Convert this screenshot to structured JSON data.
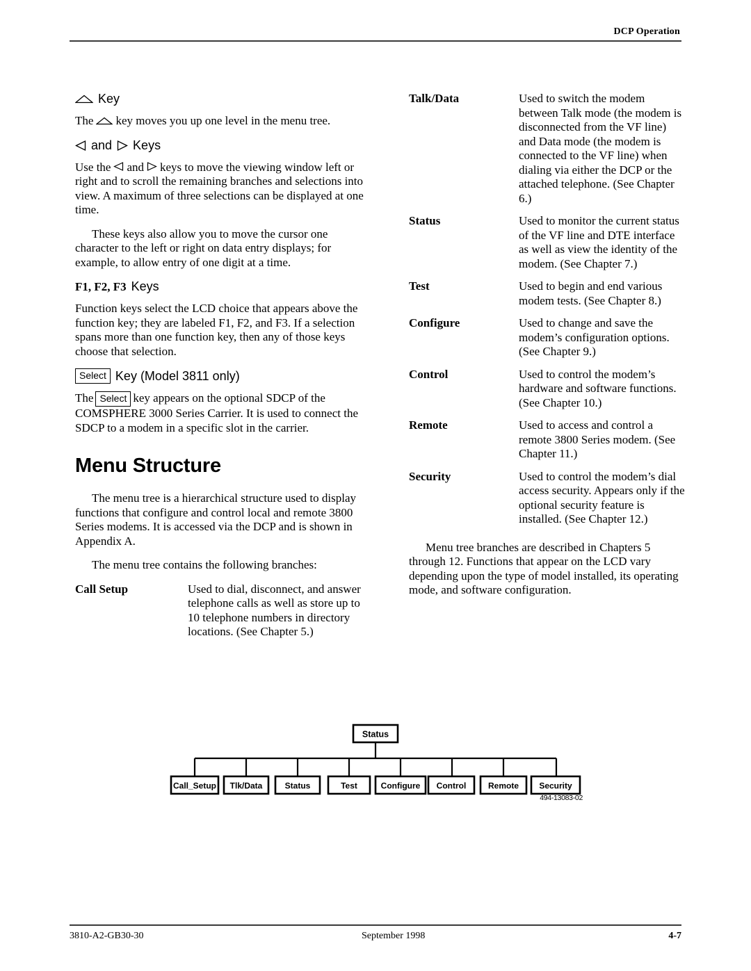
{
  "header": {
    "title": "DCP Operation"
  },
  "footer": {
    "doc_number": "3810-A2-GB30-30",
    "date": "September 1998",
    "page_number": "4-7"
  },
  "left_column": {
    "up_key_heading": {
      "glyph": "up-triangle-icon",
      "label": "Key"
    },
    "up_key_para_a": "The",
    "up_key_para_b": "key moves you up one level in the menu tree.",
    "lr_key_heading": {
      "left_glyph": "left-triangle-icon",
      "and": "and",
      "right_glyph": "right-triangle-icon",
      "label": "Keys"
    },
    "lr_key_para_a": "Use the",
    "lr_key_para_b": "and",
    "lr_key_para_c": "keys to move the viewing window left or right and to scroll the remaining branches and selections into view. A maximum of three selections can be displayed at one time.",
    "cursor_para": "These keys also allow you to move the cursor one character to the left or right on data entry displays; for example, to allow entry of one digit at a time.",
    "function_keys_heading": {
      "bold_part": "F1, F2, F3",
      "label": "Keys"
    },
    "function_keys_para": "Function keys select the LCD choice that appears above the function key; they are labeled F1, F2, and F3. If a selection spans more than one function key, then any of those keys choose that selection.",
    "select_key_heading": {
      "keybox": "Select",
      "label": "Key (Model 3811 only)"
    },
    "select_para_a": "The",
    "select_para_keybox": "Select",
    "select_para_b": "key appears on the optional SDCP of the COMSPHERE 3000 Series Carrier. It is used to connect the SDCP to a modem in a specific slot in the carrier.",
    "menu_structure_title": "Menu Structure",
    "menu_structure_para1": "The menu tree is a hierarchical structure used to display functions that configure and control local and remote 3800 Series modems. It is accessed via the DCP and is shown in Appendix A.",
    "menu_structure_para2": "The menu tree contains the following branches:",
    "branches": [
      {
        "term": "Call Setup",
        "description": "Used to dial, disconnect, and answer telephone calls as well as store up to 10 telephone numbers in directory locations. (See Chapter 5.)"
      }
    ]
  },
  "right_column": {
    "branches": [
      {
        "term": "Talk/Data",
        "description": "Used to switch the modem between Talk mode (the modem is disconnected from the VF line) and Data mode (the modem is connected to the VF line) when dialing via either the DCP or the attached telephone. (See Chapter 6.)"
      },
      {
        "term": "Status",
        "description": "Used to monitor the current status of the VF line and DTE interface as well as view the identity of the modem. (See Chapter 7.)"
      },
      {
        "term": "Test",
        "description": "Used to begin and end various modem tests. (See Chapter 8.)"
      },
      {
        "term": "Configure",
        "description": "Used to change and save the modem’s configuration options. (See Chapter 9.)"
      },
      {
        "term": "Control",
        "description": "Used to control the modem’s hardware and software functions. (See Chapter 10.)"
      },
      {
        "term": "Remote",
        "description": "Used to access and control a remote 3800 Series modem. (See Chapter 11.)"
      },
      {
        "term": "Security",
        "description": "Used to control the modem’s dial access security. Appears only if the optional security feature is installed. (See Chapter 12.)"
      }
    ],
    "closing_para": "Menu tree branches are described in Chapters 5 through 12. Functions that appear on the LCD vary depending upon the type of model installed, its operating mode, and software configuration."
  },
  "figure": {
    "root": "Status",
    "children": [
      "Call_Setup",
      "Tlk/Data",
      "Status",
      "Test",
      "Configure",
      "Control",
      "Remote",
      "Security"
    ],
    "figure_id": "494-13083-02"
  }
}
